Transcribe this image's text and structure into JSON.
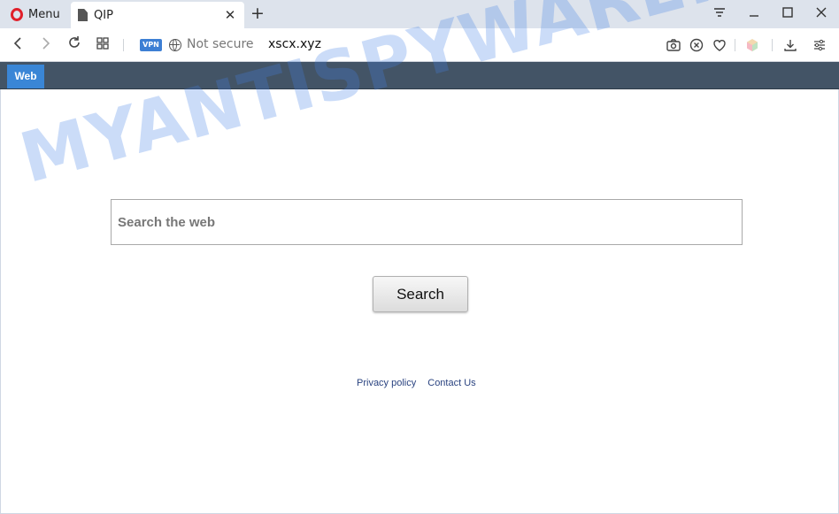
{
  "browser": {
    "menu_label": "Menu",
    "tab_title": "QIP",
    "vpn_badge": "VPN",
    "security_label": "Not secure",
    "url": "xscx.xyz"
  },
  "page": {
    "strip_tab_label": "Web",
    "search_placeholder": "Search the web",
    "search_button": "Search",
    "footer": {
      "privacy": "Privacy policy",
      "contact": "Contact Us"
    },
    "watermark": "MYANTISPYWARE.COM"
  },
  "colors": {
    "strip_bg": "#435466",
    "web_tab": "#3a86d6",
    "link": "#2a4380"
  }
}
